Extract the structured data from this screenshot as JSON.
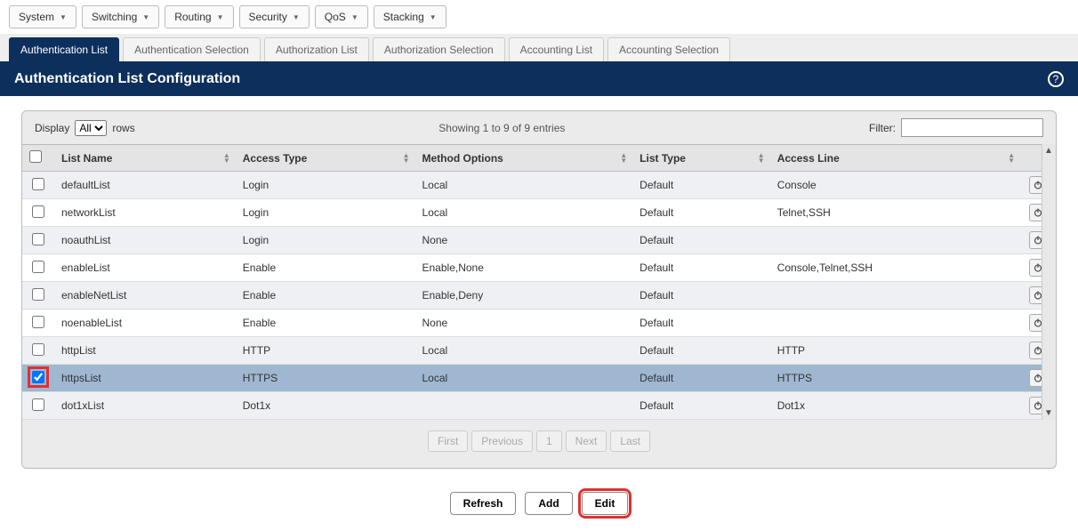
{
  "top_nav": [
    "System",
    "Switching",
    "Routing",
    "Security",
    "QoS",
    "Stacking"
  ],
  "tabs": {
    "items": [
      "Authentication List",
      "Authentication Selection",
      "Authorization List",
      "Authorization Selection",
      "Accounting List",
      "Accounting Selection"
    ],
    "active_index": 0
  },
  "page_title": "Authentication List Configuration",
  "controls": {
    "display_label": "Display",
    "display_value": "All",
    "rows_label": "rows",
    "info": "Showing 1 to 9 of 9 entries",
    "filter_label": "Filter:",
    "filter_value": ""
  },
  "columns": [
    "List Name",
    "Access Type",
    "Method Options",
    "List Type",
    "Access Line"
  ],
  "rows": [
    {
      "checked": false,
      "selected": false,
      "list_name": "defaultList",
      "access_type": "Login",
      "method_options": "Local",
      "list_type": "Default",
      "access_line": "Console"
    },
    {
      "checked": false,
      "selected": false,
      "list_name": "networkList",
      "access_type": "Login",
      "method_options": "Local",
      "list_type": "Default",
      "access_line": "Telnet,SSH"
    },
    {
      "checked": false,
      "selected": false,
      "list_name": "noauthList",
      "access_type": "Login",
      "method_options": "None",
      "list_type": "Default",
      "access_line": ""
    },
    {
      "checked": false,
      "selected": false,
      "list_name": "enableList",
      "access_type": "Enable",
      "method_options": "Enable,None",
      "list_type": "Default",
      "access_line": "Console,Telnet,SSH"
    },
    {
      "checked": false,
      "selected": false,
      "list_name": "enableNetList",
      "access_type": "Enable",
      "method_options": "Enable,Deny",
      "list_type": "Default",
      "access_line": ""
    },
    {
      "checked": false,
      "selected": false,
      "list_name": "noenableList",
      "access_type": "Enable",
      "method_options": "None",
      "list_type": "Default",
      "access_line": ""
    },
    {
      "checked": false,
      "selected": false,
      "list_name": "httpList",
      "access_type": "HTTP",
      "method_options": "Local",
      "list_type": "Default",
      "access_line": "HTTP"
    },
    {
      "checked": true,
      "selected": true,
      "list_name": "httpsList",
      "access_type": "HTTPS",
      "method_options": "Local",
      "list_type": "Default",
      "access_line": "HTTPS"
    },
    {
      "checked": false,
      "selected": false,
      "list_name": "dot1xList",
      "access_type": "Dot1x",
      "method_options": "",
      "list_type": "Default",
      "access_line": "Dot1x"
    }
  ],
  "pager": {
    "first": "First",
    "previous": "Previous",
    "page": "1",
    "next": "Next",
    "last": "Last"
  },
  "actions": {
    "refresh": "Refresh",
    "add": "Add",
    "edit": "Edit"
  },
  "highlight_row_index": 7,
  "highlight_action": "edit"
}
